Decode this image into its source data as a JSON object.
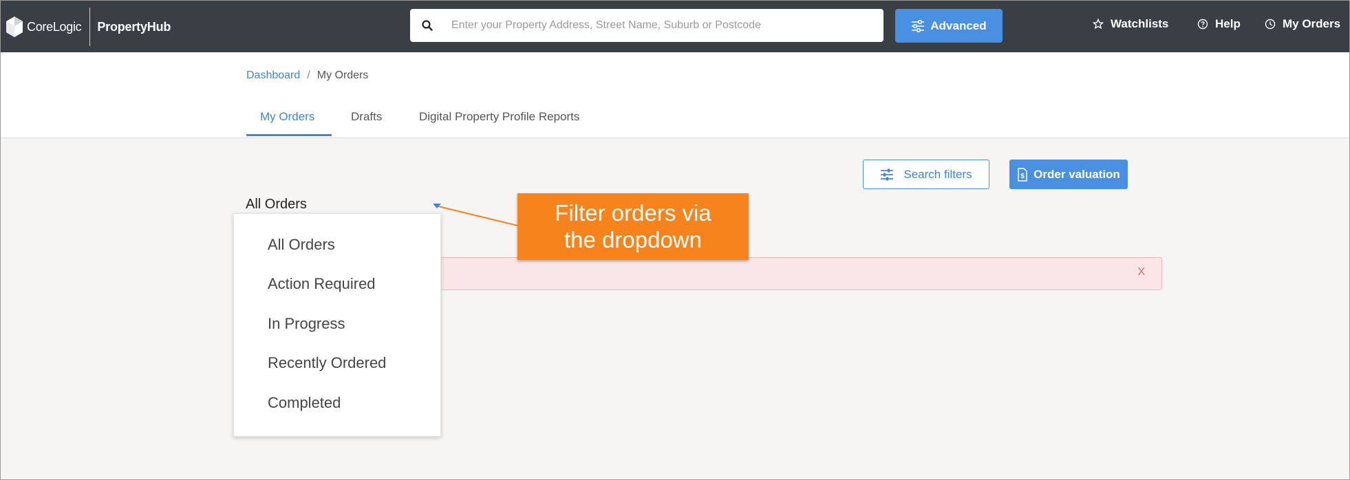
{
  "header": {
    "brand": "CoreLogic",
    "product": "PropertyHub",
    "search": {
      "placeholder": "Enter your Property Address, Street Name, Suburb or Postcode",
      "value": ""
    },
    "advanced_label": "Advanced",
    "nav": {
      "watchlists": "Watchlists",
      "help": "Help",
      "my_orders": "My Orders"
    }
  },
  "breadcrumb": {
    "root": "Dashboard",
    "separator": "/",
    "current": "My Orders"
  },
  "tabs": [
    {
      "label": "My Orders",
      "active": true
    },
    {
      "label": "Drafts",
      "active": false
    },
    {
      "label": "Digital Property Profile Reports",
      "active": false
    }
  ],
  "actions": {
    "search_filters": "Search filters",
    "order_valuation": "Order valuation"
  },
  "filter": {
    "selected": "All Orders",
    "options": [
      "All Orders",
      "Action Required",
      "In Progress",
      "Recently Ordered",
      "Completed"
    ]
  },
  "alert": {
    "close": "X"
  },
  "callout": {
    "line1": "Filter orders via",
    "line2": "the dropdown"
  },
  "colors": {
    "topbar": "#3a3f46",
    "accent": "#4a90e2",
    "callout": "#f7831c",
    "alert_bg": "#fae6e6"
  }
}
